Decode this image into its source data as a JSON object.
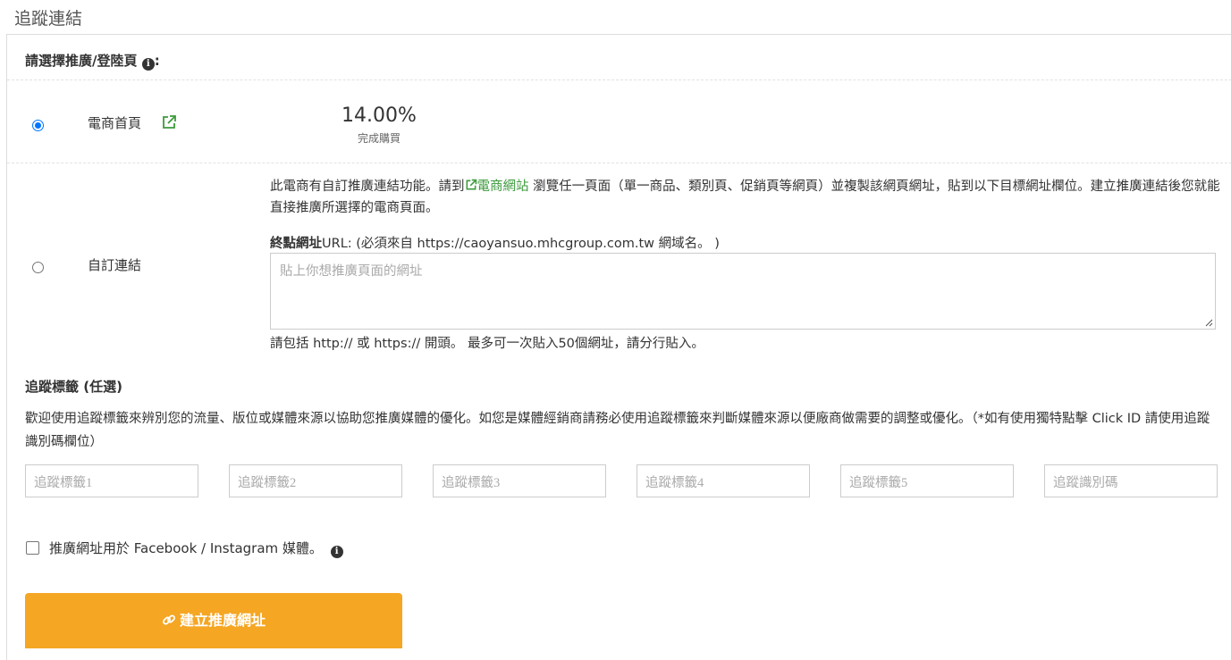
{
  "page": {
    "title": "追蹤連結"
  },
  "landing": {
    "heading": "請選擇推廣/登陸頁",
    "heading_suffix": ":",
    "info_icon": "info-circle-icon",
    "options": {
      "ecommerce_home": {
        "label": "電商首頁",
        "selected": true,
        "icon": "external-link-icon",
        "rate_value": "14.00%",
        "rate_caption": "完成購買"
      },
      "custom_link": {
        "label": "自訂連結",
        "selected": false,
        "description_before": "此電商有自訂推廣連結功能。請到",
        "description_link": "電商網站",
        "description_after": " 瀏覽任一頁面（單一商品、類別頁、促銷頁等網頁）並複製該網頁網址，貼到以下目標網址欄位。建立推廣連結後您就能直接推廣所選擇的電商頁面。",
        "url_label_bold": "終點網址",
        "url_label_rest": "URL: (必須來自 https://caoyansuo.mhcgroup.com.tw 網域名。 )",
        "url_placeholder": "貼上你想推廣頁面的網址",
        "url_hint": "請包括 http:// 或 https:// 開頭。 最多可一次貼入50個網址，請分行貼入。"
      }
    }
  },
  "tracking": {
    "heading": "追蹤標籤 (任選)",
    "description": "歡迎使用追蹤標籤來辨別您的流量、版位或媒體來源以協助您推廣媒體的優化。如您是媒體經銷商請務必使用追蹤標籤來判斷媒體來源以便廠商做需要的調整或優化。（*如有使用獨特點擊 Click ID 請使用追蹤識別碼欄位）",
    "inputs": [
      {
        "placeholder": "追蹤標籤1"
      },
      {
        "placeholder": "追蹤標籤2"
      },
      {
        "placeholder": "追蹤標籤3"
      },
      {
        "placeholder": "追蹤標籤4"
      },
      {
        "placeholder": "追蹤標籤5"
      },
      {
        "placeholder": "追蹤識別碼"
      }
    ]
  },
  "facebook": {
    "label": "推廣網址用於 Facebook / Instagram 媒體。",
    "checked": false,
    "info_icon": "info-circle-icon"
  },
  "actions": {
    "create_label": "建立推廣網址",
    "create_icon": "link-icon"
  },
  "colors": {
    "accent_orange": "#f5a623",
    "link_green": "#3c9a3c",
    "radio_blue": "#0075ff"
  }
}
